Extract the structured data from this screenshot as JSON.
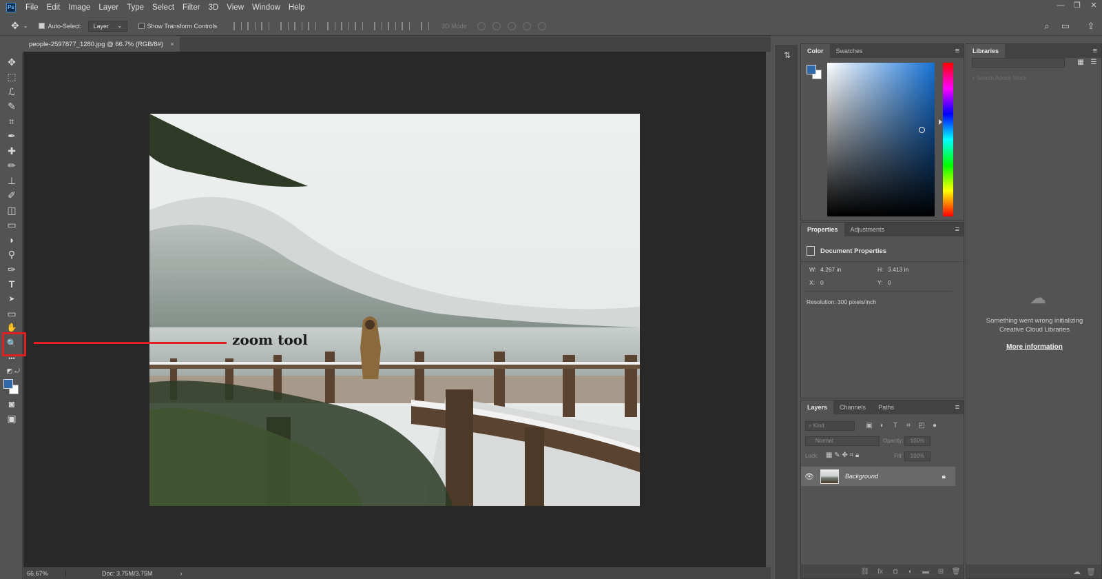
{
  "app": {
    "logo": "Ps"
  },
  "menu": [
    "File",
    "Edit",
    "Image",
    "Layer",
    "Type",
    "Select",
    "Filter",
    "3D",
    "View",
    "Window",
    "Help"
  ],
  "window_controls": {
    "minimize": "—",
    "restore": "❐",
    "close": "✕"
  },
  "options_bar": {
    "auto_select_label": "Auto-Select:",
    "auto_select_checked": true,
    "auto_select_target": "Layer",
    "show_transform_label": "Show Transform Controls",
    "show_transform_checked": false,
    "mode_3d_label": "3D Mode:"
  },
  "document": {
    "tab_title": "people-2597877_1280.jpg @ 66.7% (RGB/8#)",
    "close_glyph": "×"
  },
  "annotation": {
    "text": "zoom tool",
    "color": "#e02020"
  },
  "status": {
    "zoom": "66.67%",
    "doc_size": "Doc: 3.75M/3.75M",
    "arrow": "›"
  },
  "tools": [
    {
      "name": "move-tool",
      "glyph": "✥"
    },
    {
      "name": "marquee-tool",
      "glyph": "⬚"
    },
    {
      "name": "lasso-tool",
      "glyph": "ℒ"
    },
    {
      "name": "quick-select-tool",
      "glyph": "✎"
    },
    {
      "name": "crop-tool",
      "glyph": "⌗"
    },
    {
      "name": "eyedropper-tool",
      "glyph": "✒"
    },
    {
      "name": "healing-brush-tool",
      "glyph": "✚"
    },
    {
      "name": "brush-tool",
      "glyph": "✏"
    },
    {
      "name": "clone-stamp-tool",
      "glyph": "⊥"
    },
    {
      "name": "history-brush-tool",
      "glyph": "✐"
    },
    {
      "name": "eraser-tool",
      "glyph": "◫"
    },
    {
      "name": "gradient-tool",
      "glyph": "▭"
    },
    {
      "name": "blur-tool",
      "glyph": "◗"
    },
    {
      "name": "dodge-tool",
      "glyph": "⚲"
    },
    {
      "name": "pen-tool",
      "glyph": "✑"
    },
    {
      "name": "type-tool",
      "glyph": "T"
    },
    {
      "name": "path-selection-tool",
      "glyph": "➤"
    },
    {
      "name": "rectangle-tool",
      "glyph": "▭"
    },
    {
      "name": "hand-tool",
      "glyph": "✋"
    },
    {
      "name": "zoom-tool",
      "glyph": "🔍"
    },
    {
      "name": "more-tools",
      "glyph": "•••"
    }
  ],
  "color_panel": {
    "tabs": [
      "Color",
      "Swatches"
    ],
    "foreground": "#2f67a9",
    "background": "#ffffff"
  },
  "properties_panel": {
    "tabs": [
      "Properties",
      "Adjustments"
    ],
    "title": "Document Properties",
    "w_label": "W:",
    "w_value": "4.267 in",
    "h_label": "H:",
    "h_value": "3.413 in",
    "x_label": "X:",
    "x_value": "0",
    "y_label": "Y:",
    "y_value": "0",
    "resolution": "Resolution: 300 pixels/inch"
  },
  "layers_panel": {
    "tabs": [
      "Layers",
      "Channels",
      "Paths"
    ],
    "kind_placeholder": "Kind",
    "blend_mode": "Normal",
    "opacity_label": "Opacity:",
    "opacity_value": "100%",
    "lock_label": "Lock:",
    "fill_label": "Fill:",
    "fill_value": "100%",
    "layer_name": "Background",
    "footer_icons": [
      "link-icon",
      "fx-icon",
      "mask-icon",
      "adjustment-icon",
      "folder-icon",
      "new-layer-icon",
      "trash-icon"
    ]
  },
  "libraries_panel": {
    "tab": "Libraries",
    "search_placeholder": "Search Adobe Stock",
    "error_line1": "Something went wrong initializing",
    "error_line2": "Creative Cloud Libraries",
    "link": "More information"
  }
}
